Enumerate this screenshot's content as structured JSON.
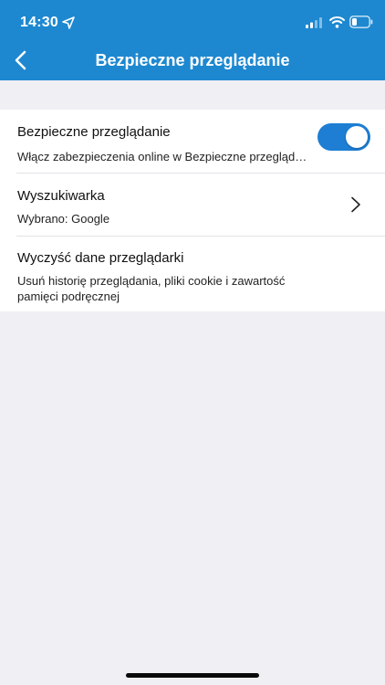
{
  "status_bar": {
    "time": "14:30",
    "icons": [
      "location-arrow-icon",
      "cellular-signal-icon",
      "wifi-icon",
      "battery-icon"
    ]
  },
  "nav": {
    "title": "Bezpieczne przeglądanie",
    "back_icon": "chevron-left-icon"
  },
  "settings": [
    {
      "title": "Bezpieczne przeglądanie",
      "subtitle": "Włącz zabezpieczenia online w Bezpieczne przeglądanie",
      "toggle_on": true
    },
    {
      "title": "Wyszukiwarka",
      "subtitle": "Wybrano: Google",
      "chevron_icon": "chevron-right-icon"
    },
    {
      "title": "Wyczyść dane przeglądarki",
      "subtitle": "Usuń historię przeglądania, pliki cookie i zawartość pamięci podręcznej"
    }
  ],
  "colors": {
    "header_bg": "#1d88d0",
    "toggle_on": "#1d7ed4",
    "page_bg": "#efeff4"
  }
}
